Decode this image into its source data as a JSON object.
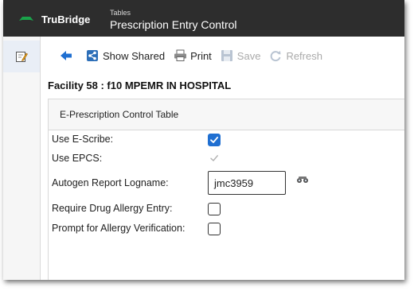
{
  "header": {
    "brand": "TruBridge",
    "breadcrumb": "Tables",
    "title": "Prescription Entry Control",
    "brand_color": "#1aa34a"
  },
  "sidebar": {
    "items": [
      {
        "icon": "edit-note-icon",
        "active": true
      }
    ]
  },
  "toolbar": {
    "back_icon": "back-arrow-icon",
    "show_shared_label": "Show Shared",
    "print_label": "Print",
    "save_label": "Save",
    "refresh_label": "Refresh"
  },
  "facility_line": "Facility 58 : f10 MPEMR IN HOSPITAL",
  "panel": {
    "title": "E-Prescription Control Table",
    "fields": {
      "use_escribe": {
        "label": "Use E-Scribe:",
        "checked": true
      },
      "use_epcs": {
        "label": "Use EPCS:",
        "checked": true,
        "disabled": true
      },
      "autogen_logname": {
        "label": "Autogen Report Logname:",
        "value": "jmc3959"
      },
      "require_drug_allergy": {
        "label": "Require Drug Allergy Entry:",
        "checked": false
      },
      "prompt_allergy_verification": {
        "label": "Prompt for Allergy Verification:",
        "checked": false
      }
    }
  },
  "colors": {
    "titlebar": "#2d2d2d",
    "checkbox_checked": "#1f6fd1",
    "back_arrow": "#1f6fd1"
  }
}
